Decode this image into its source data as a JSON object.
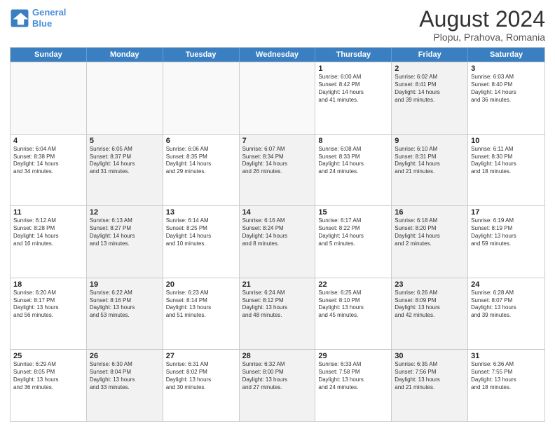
{
  "logo": {
    "line1": "General",
    "line2": "Blue"
  },
  "title": "August 2024",
  "subtitle": "Plopu, Prahova, Romania",
  "header_days": [
    "Sunday",
    "Monday",
    "Tuesday",
    "Wednesday",
    "Thursday",
    "Friday",
    "Saturday"
  ],
  "rows": [
    [
      {
        "day": "",
        "info": "",
        "shaded": false,
        "empty": true
      },
      {
        "day": "",
        "info": "",
        "shaded": false,
        "empty": true
      },
      {
        "day": "",
        "info": "",
        "shaded": false,
        "empty": true
      },
      {
        "day": "",
        "info": "",
        "shaded": false,
        "empty": true
      },
      {
        "day": "1",
        "info": "Sunrise: 6:00 AM\nSunset: 8:42 PM\nDaylight: 14 hours\nand 41 minutes.",
        "shaded": false,
        "empty": false
      },
      {
        "day": "2",
        "info": "Sunrise: 6:02 AM\nSunset: 8:41 PM\nDaylight: 14 hours\nand 39 minutes.",
        "shaded": true,
        "empty": false
      },
      {
        "day": "3",
        "info": "Sunrise: 6:03 AM\nSunset: 8:40 PM\nDaylight: 14 hours\nand 36 minutes.",
        "shaded": false,
        "empty": false
      }
    ],
    [
      {
        "day": "4",
        "info": "Sunrise: 6:04 AM\nSunset: 8:38 PM\nDaylight: 14 hours\nand 34 minutes.",
        "shaded": false,
        "empty": false
      },
      {
        "day": "5",
        "info": "Sunrise: 6:05 AM\nSunset: 8:37 PM\nDaylight: 14 hours\nand 31 minutes.",
        "shaded": true,
        "empty": false
      },
      {
        "day": "6",
        "info": "Sunrise: 6:06 AM\nSunset: 8:35 PM\nDaylight: 14 hours\nand 29 minutes.",
        "shaded": false,
        "empty": false
      },
      {
        "day": "7",
        "info": "Sunrise: 6:07 AM\nSunset: 8:34 PM\nDaylight: 14 hours\nand 26 minutes.",
        "shaded": true,
        "empty": false
      },
      {
        "day": "8",
        "info": "Sunrise: 6:08 AM\nSunset: 8:33 PM\nDaylight: 14 hours\nand 24 minutes.",
        "shaded": false,
        "empty": false
      },
      {
        "day": "9",
        "info": "Sunrise: 6:10 AM\nSunset: 8:31 PM\nDaylight: 14 hours\nand 21 minutes.",
        "shaded": true,
        "empty": false
      },
      {
        "day": "10",
        "info": "Sunrise: 6:11 AM\nSunset: 8:30 PM\nDaylight: 14 hours\nand 18 minutes.",
        "shaded": false,
        "empty": false
      }
    ],
    [
      {
        "day": "11",
        "info": "Sunrise: 6:12 AM\nSunset: 8:28 PM\nDaylight: 14 hours\nand 16 minutes.",
        "shaded": false,
        "empty": false
      },
      {
        "day": "12",
        "info": "Sunrise: 6:13 AM\nSunset: 8:27 PM\nDaylight: 14 hours\nand 13 minutes.",
        "shaded": true,
        "empty": false
      },
      {
        "day": "13",
        "info": "Sunrise: 6:14 AM\nSunset: 8:25 PM\nDaylight: 14 hours\nand 10 minutes.",
        "shaded": false,
        "empty": false
      },
      {
        "day": "14",
        "info": "Sunrise: 6:16 AM\nSunset: 8:24 PM\nDaylight: 14 hours\nand 8 minutes.",
        "shaded": true,
        "empty": false
      },
      {
        "day": "15",
        "info": "Sunrise: 6:17 AM\nSunset: 8:22 PM\nDaylight: 14 hours\nand 5 minutes.",
        "shaded": false,
        "empty": false
      },
      {
        "day": "16",
        "info": "Sunrise: 6:18 AM\nSunset: 8:20 PM\nDaylight: 14 hours\nand 2 minutes.",
        "shaded": true,
        "empty": false
      },
      {
        "day": "17",
        "info": "Sunrise: 6:19 AM\nSunset: 8:19 PM\nDaylight: 13 hours\nand 59 minutes.",
        "shaded": false,
        "empty": false
      }
    ],
    [
      {
        "day": "18",
        "info": "Sunrise: 6:20 AM\nSunset: 8:17 PM\nDaylight: 13 hours\nand 56 minutes.",
        "shaded": false,
        "empty": false
      },
      {
        "day": "19",
        "info": "Sunrise: 6:22 AM\nSunset: 8:16 PM\nDaylight: 13 hours\nand 53 minutes.",
        "shaded": true,
        "empty": false
      },
      {
        "day": "20",
        "info": "Sunrise: 6:23 AM\nSunset: 8:14 PM\nDaylight: 13 hours\nand 51 minutes.",
        "shaded": false,
        "empty": false
      },
      {
        "day": "21",
        "info": "Sunrise: 6:24 AM\nSunset: 8:12 PM\nDaylight: 13 hours\nand 48 minutes.",
        "shaded": true,
        "empty": false
      },
      {
        "day": "22",
        "info": "Sunrise: 6:25 AM\nSunset: 8:10 PM\nDaylight: 13 hours\nand 45 minutes.",
        "shaded": false,
        "empty": false
      },
      {
        "day": "23",
        "info": "Sunrise: 6:26 AM\nSunset: 8:09 PM\nDaylight: 13 hours\nand 42 minutes.",
        "shaded": true,
        "empty": false
      },
      {
        "day": "24",
        "info": "Sunrise: 6:28 AM\nSunset: 8:07 PM\nDaylight: 13 hours\nand 39 minutes.",
        "shaded": false,
        "empty": false
      }
    ],
    [
      {
        "day": "25",
        "info": "Sunrise: 6:29 AM\nSunset: 8:05 PM\nDaylight: 13 hours\nand 36 minutes.",
        "shaded": false,
        "empty": false
      },
      {
        "day": "26",
        "info": "Sunrise: 6:30 AM\nSunset: 8:04 PM\nDaylight: 13 hours\nand 33 minutes.",
        "shaded": true,
        "empty": false
      },
      {
        "day": "27",
        "info": "Sunrise: 6:31 AM\nSunset: 8:02 PM\nDaylight: 13 hours\nand 30 minutes.",
        "shaded": false,
        "empty": false
      },
      {
        "day": "28",
        "info": "Sunrise: 6:32 AM\nSunset: 8:00 PM\nDaylight: 13 hours\nand 27 minutes.",
        "shaded": true,
        "empty": false
      },
      {
        "day": "29",
        "info": "Sunrise: 6:33 AM\nSunset: 7:58 PM\nDaylight: 13 hours\nand 24 minutes.",
        "shaded": false,
        "empty": false
      },
      {
        "day": "30",
        "info": "Sunrise: 6:35 AM\nSunset: 7:56 PM\nDaylight: 13 hours\nand 21 minutes.",
        "shaded": true,
        "empty": false
      },
      {
        "day": "31",
        "info": "Sunrise: 6:36 AM\nSunset: 7:55 PM\nDaylight: 13 hours\nand 18 minutes.",
        "shaded": false,
        "empty": false
      }
    ]
  ]
}
